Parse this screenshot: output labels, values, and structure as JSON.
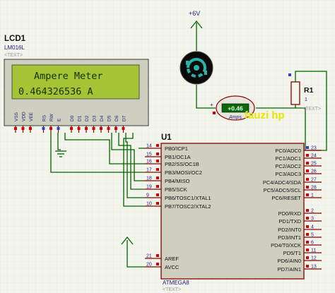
{
  "supply": {
    "label": "+6V"
  },
  "lcd": {
    "ref": "LCD1",
    "model": "LM016L",
    "text_placeholder": "<TEXT>",
    "line1": "Ampere Meter",
    "line2": "0.464326536 A",
    "pins": [
      "VSS",
      "VDD",
      "VEE",
      "RS",
      "RW",
      "E",
      "D0",
      "D1",
      "D2",
      "D3",
      "D4",
      "D5",
      "D6",
      "D7"
    ]
  },
  "ammeter": {
    "value": "+0.46",
    "unit": "Amps"
  },
  "resistor": {
    "ref": "R1",
    "pin": "1",
    "text_placeholder": "<TEXT>"
  },
  "watermark": "fauzi hp",
  "mcu": {
    "ref": "U1",
    "part": "ATMEGA8",
    "text_placeholder": "<TEXT>",
    "left_pins": [
      {
        "num": "14",
        "name": "PB0/ICP1"
      },
      {
        "num": "15",
        "name": "PB1/OC1A"
      },
      {
        "num": "16",
        "name": "PB2/SS/OC1B"
      },
      {
        "num": "17",
        "name": "PB3/MOSI/OC2"
      },
      {
        "num": "18",
        "name": "PB4/MISO"
      },
      {
        "num": "19",
        "name": "PB5/SCK"
      },
      {
        "num": "9",
        "name": "PB6/TOSC1/XTAL1"
      },
      {
        "num": "10",
        "name": "PB7/TOSC2/XTAL2"
      },
      {
        "num": "21",
        "name": "AREF"
      },
      {
        "num": "20",
        "name": "AVCC"
      }
    ],
    "right_pins": [
      {
        "num": "23",
        "name": "PC0/ADC0"
      },
      {
        "num": "24",
        "name": "PC1/ADC1"
      },
      {
        "num": "25",
        "name": "PC2/ADC2"
      },
      {
        "num": "26",
        "name": "PC3/ADC3"
      },
      {
        "num": "27",
        "name": "PC4/ADC4/SDA"
      },
      {
        "num": "28",
        "name": "PC5/ADC5/SCL"
      },
      {
        "num": "1",
        "name": "PC6/RESET"
      },
      {
        "num": "2",
        "name": "PD0/RXD"
      },
      {
        "num": "3",
        "name": "PD1/TXD"
      },
      {
        "num": "4",
        "name": "PD2/INT0"
      },
      {
        "num": "5",
        "name": "PD3/INT1"
      },
      {
        "num": "6",
        "name": "PD4/T0/XCK"
      },
      {
        "num": "11",
        "name": "PD5/T1"
      },
      {
        "num": "12",
        "name": "PD6/AIN0"
      },
      {
        "num": "13",
        "name": "PD7/AIN1"
      }
    ]
  },
  "colors": {
    "background": "#f3f4ec",
    "grid": "#dfe2d4",
    "wire": "#006400",
    "body_outline": "#8b0000",
    "body_fill": "#cfcfbf",
    "pin_text": "#1b1b80",
    "lcd_screen": "#a4c436",
    "lcd_text": "#143000",
    "watermark": "#e6e600",
    "pin_state_high": "#d80000",
    "pin_state_low": "#2f3fd0",
    "meter_display": "#0a6a0a"
  }
}
